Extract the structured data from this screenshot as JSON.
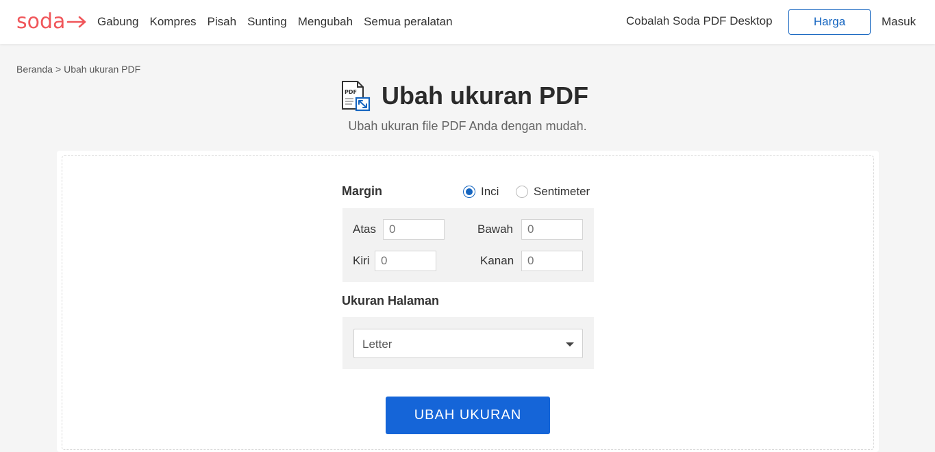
{
  "header": {
    "logo": "soda",
    "nav": [
      "Gabung",
      "Kompres",
      "Pisah",
      "Sunting",
      "Mengubah",
      "Semua peralatan"
    ],
    "try_desktop": "Cobalah Soda PDF Desktop",
    "price_label": "Harga",
    "login_label": "Masuk"
  },
  "breadcrumb": {
    "home": "Beranda",
    "separator": ">",
    "current": "Ubah ukuran PDF"
  },
  "page": {
    "title": "Ubah ukuran PDF",
    "subtitle": "Ubah ukuran file PDF Anda dengan mudah.",
    "icon": "pdf-resize-icon"
  },
  "margin": {
    "label": "Margin",
    "unit_options": [
      {
        "label": "Inci",
        "selected": true
      },
      {
        "label": "Sentimeter",
        "selected": false
      }
    ],
    "fields": {
      "top": {
        "label": "Atas",
        "placeholder": "0"
      },
      "bottom": {
        "label": "Bawah",
        "placeholder": "0"
      },
      "left": {
        "label": "Kiri",
        "placeholder": "0"
      },
      "right": {
        "label": "Kanan",
        "placeholder": "0"
      }
    }
  },
  "page_size": {
    "label": "Ukuran Halaman",
    "selected": "Letter"
  },
  "submit_label": "UBAH UKURAN",
  "colors": {
    "brand": "#f0565a",
    "accent": "#1565c0",
    "button": "#1565d8"
  }
}
